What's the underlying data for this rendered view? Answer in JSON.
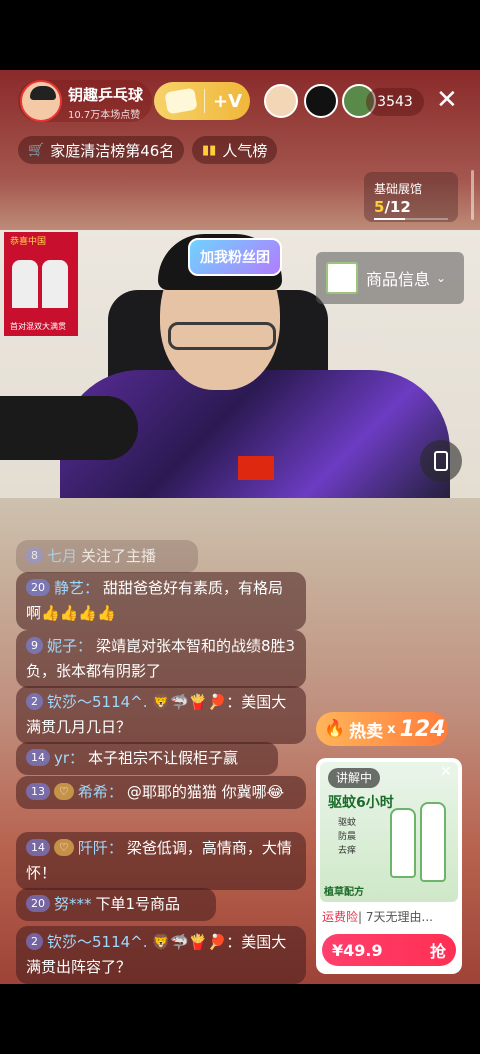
{
  "header": {
    "host_name": "钥趣乒乓球",
    "likes": "10.7万本场点赞",
    "follow_plus": "+V",
    "viewer_count": "3543",
    "close_icon": "✕"
  },
  "ranks": {
    "cleaning": "家庭清洁榜第46名",
    "popularity": "人气榜"
  },
  "showcase": {
    "title": "基础展馆",
    "current": "5",
    "total": "/12",
    "progress": 0.42
  },
  "video": {
    "fan_badge": "加我粉丝团",
    "product_info": "商品信息",
    "poster_text": "恭喜中国",
    "poster_caption": "首对混双大满贯"
  },
  "chat": [
    {
      "level": "8",
      "name": "七月",
      "text": "关注了主播"
    },
    {
      "level": "20",
      "name": "静艺：",
      "text": "甜甜爸爸好有素质，有格局啊👍👍👍👍"
    },
    {
      "level": "9",
      "name": "妮子：",
      "text": "梁靖崑对张本智和的战绩8胜3负，张本都有阴影了"
    },
    {
      "level": "2",
      "name": "钦莎～5114^.",
      "text": "🦁🦈🍟🏓：美国大满贯几月几日？"
    },
    {
      "level": "14",
      "name": "yr：",
      "text": "本子祖宗不让假柜子赢"
    },
    {
      "level": "13",
      "name": "希希：",
      "text": "@耶耶的猫猫 你冀哪😂"
    },
    {
      "level": "14",
      "name": "阡阡：",
      "text": "梁爸低调，高情商，大情怀！"
    },
    {
      "level": "20",
      "name": "努***",
      "text": "下单1号商品"
    },
    {
      "level": "2",
      "name": "钦莎～5114^.",
      "text": "🦁🦈🍟🏓：美国大满贯出阵容了？"
    }
  ],
  "product": {
    "hot_label": "热卖",
    "hot_x": "x",
    "hot_count": "124",
    "explaining": "讲解中",
    "heading_part": "驱蚊6小时",
    "bullets": [
      "驱蚊",
      "防晨",
      "去痒"
    ],
    "brand": "植草配方",
    "desc_tag": "运费险",
    "desc_text": "| 7天无理由...",
    "price": "¥49.9",
    "buy_label": "抢"
  }
}
